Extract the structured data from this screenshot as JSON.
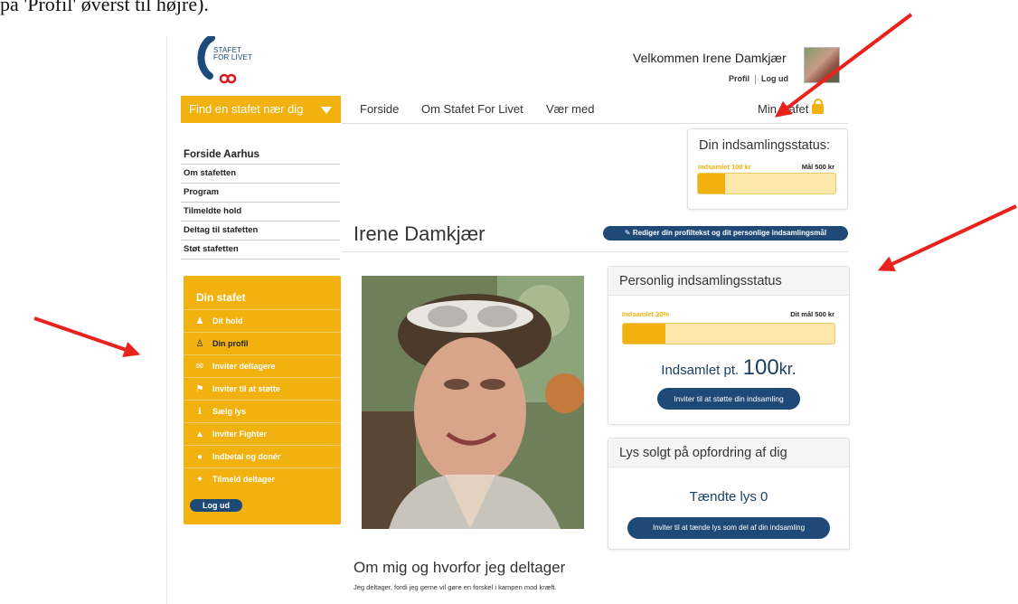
{
  "caption": "på 'Profil' øverst til højre).",
  "logo": {
    "line1": "STAFET",
    "line2": "FOR LIVET"
  },
  "header": {
    "welcome": "Velkommen Irene Damkjær",
    "profil": "Profil",
    "logud": "Log ud"
  },
  "find_button": "Find en stafet nær dig",
  "nav": {
    "forside": "Forside",
    "om": "Om Stafet For Livet",
    "vaer_med": "Vær med",
    "min_stafet": "Min stafet"
  },
  "sidenav": {
    "heading": "Forside Aarhus",
    "items": [
      "Om stafetten",
      "Program",
      "Tilmeldte hold",
      "Deltag til stafetten",
      "Støt stafetten"
    ]
  },
  "din_stafet": {
    "title": "Din stafet",
    "items": [
      {
        "label": "Dit hold",
        "icon": "group-icon"
      },
      {
        "label": "Din profil",
        "icon": "person-icon"
      },
      {
        "label": "Inviter deltagere",
        "icon": "envelope-icon"
      },
      {
        "label": "Inviter til at støtte",
        "icon": "flag-icon"
      },
      {
        "label": "Sælg lys",
        "icon": "candle-icon"
      },
      {
        "label": "Inviter Fighter",
        "icon": "tshirt-icon"
      },
      {
        "label": "Indbetal og donér",
        "icon": "piggybank-icon"
      },
      {
        "label": "Tilmeld deltager",
        "icon": "runner-icon"
      }
    ],
    "logout": "Log ud"
  },
  "status_box": {
    "title": "Din indsamlingsstatus:",
    "collected": "Indsamlet 100 kr",
    "goal": "Mål 500 kr",
    "progress": 0.2
  },
  "profile": {
    "name": "Irene Damkjær",
    "edit_button": "Rediger din profiltekst og dit personlige indsamlingsmål"
  },
  "personal_status": {
    "title": "Personlig indsamlingsstatus",
    "collected_pct": "Indsamlet 20%",
    "goal": "Dit mål 500 kr",
    "progress": 0.2,
    "amount_prefix": "Indsamlet pt.",
    "amount_value": "100",
    "amount_suffix": "kr.",
    "invite_button": "Inviter til at støtte din indsamling"
  },
  "lys": {
    "title": "Lys solgt på opfordring af dig",
    "lit": "Tændte lys 0",
    "invite_button": "Inviter til at tænde lys som del af din indsamling"
  },
  "about": {
    "heading": "Om mig og hvorfor jeg deltager",
    "text": "Jeg deltager, fordi jeg gerne vil gøre en forskel i kampen mod kræft."
  },
  "colors": {
    "accent": "#f1b20f",
    "navy": "#1f4a77",
    "arrow": "#e8231e"
  }
}
